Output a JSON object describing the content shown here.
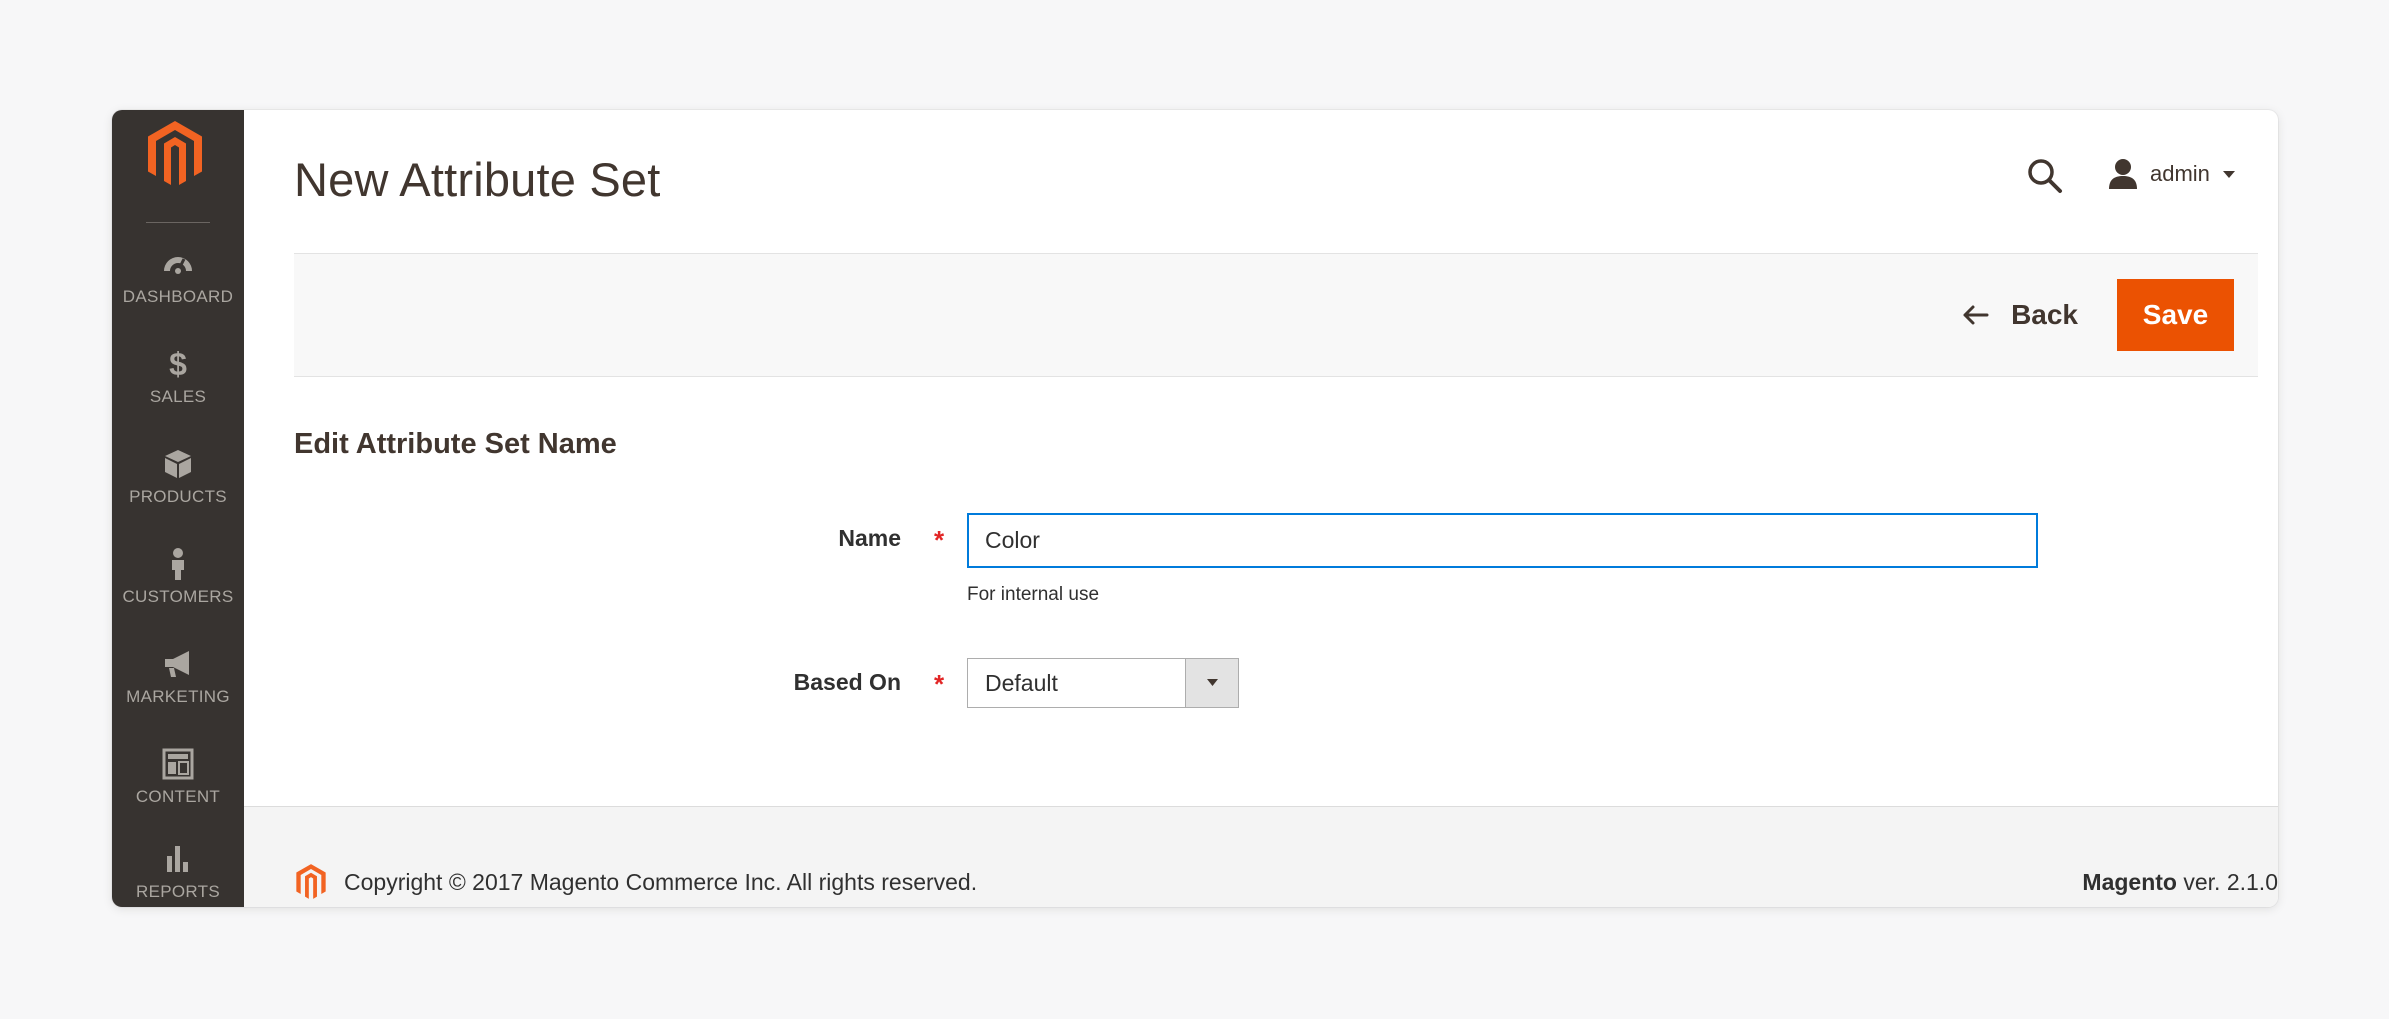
{
  "header": {
    "title": "New Attribute Set",
    "user_name": "admin"
  },
  "icons": {
    "logo": "magento-logo-icon",
    "search": "search-icon",
    "user": "user-icon",
    "caret": "caret-down-icon",
    "back": "arrow-left-icon"
  },
  "sidebar": {
    "items": [
      {
        "label": "DASHBOARD",
        "icon": "dashboard-icon"
      },
      {
        "label": "SALES",
        "icon": "dollar-icon"
      },
      {
        "label": "PRODUCTS",
        "icon": "box-icon"
      },
      {
        "label": "CUSTOMERS",
        "icon": "person-icon"
      },
      {
        "label": "MARKETING",
        "icon": "megaphone-icon"
      },
      {
        "label": "CONTENT",
        "icon": "layout-icon"
      },
      {
        "label": "REPORTS",
        "icon": "bar-chart-icon"
      }
    ]
  },
  "actions": {
    "back_label": "Back",
    "save_label": "Save"
  },
  "form": {
    "section_title": "Edit Attribute Set Name",
    "name_label": "Name",
    "name_value": "Color",
    "name_note": "For internal use",
    "based_on_label": "Based On",
    "based_on_value": "Default",
    "required_mark": "*"
  },
  "footer": {
    "copyright": "Copyright © 2017 Magento Commerce Inc. All rights reserved.",
    "version_brand": "Magento",
    "version_text": " ver. 2.1.0"
  },
  "colors": {
    "accent": "#eb5202",
    "sidebar_bg": "#373330",
    "focus_border": "#007bdb",
    "required": "#e22626"
  }
}
